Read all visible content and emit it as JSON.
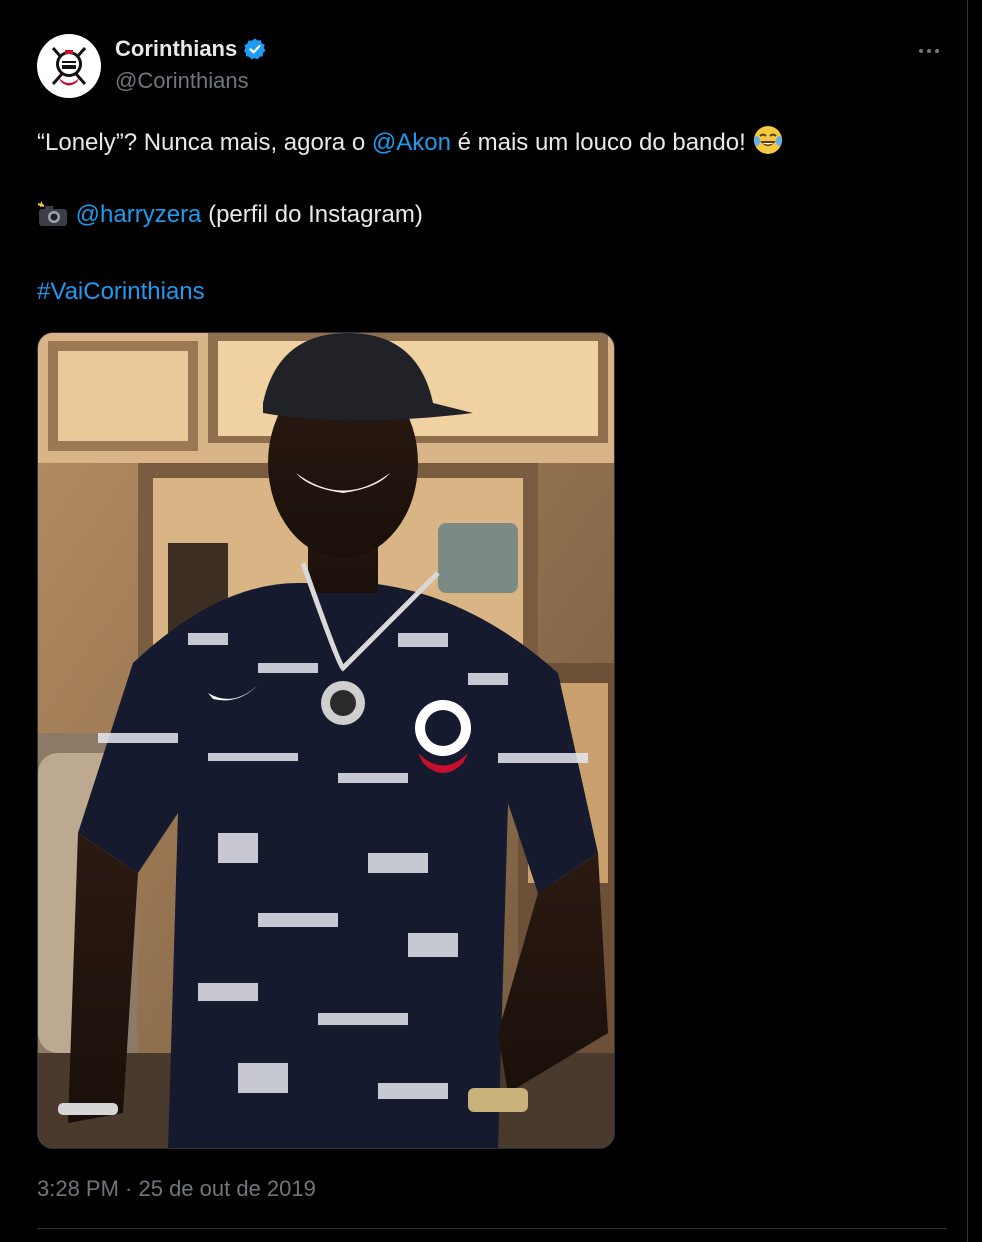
{
  "author": {
    "display_name": "Corinthians",
    "handle": "@Corinthians",
    "verified": true,
    "avatar_icon": "corinthians-crest-icon"
  },
  "tweet": {
    "line1_pre": "“Lonely”? Nunca mais, agora o ",
    "line1_mention": "@Akon",
    "line1_post": " é mais um louco do bando! ",
    "line1_emoji": "😂",
    "line2_emoji": "📸",
    "line2_mention": "@harryzera",
    "line2_post": " (perfil do Instagram)",
    "hashtag": "#VaiCorinthians",
    "media_alt": "photo"
  },
  "meta": {
    "timestamp": "3:28 PM · 25 de out de 2019"
  },
  "colors": {
    "background": "#000000",
    "text": "#e7e9ea",
    "muted": "#71767b",
    "link": "#1d9bf0",
    "border": "#2f3336"
  }
}
